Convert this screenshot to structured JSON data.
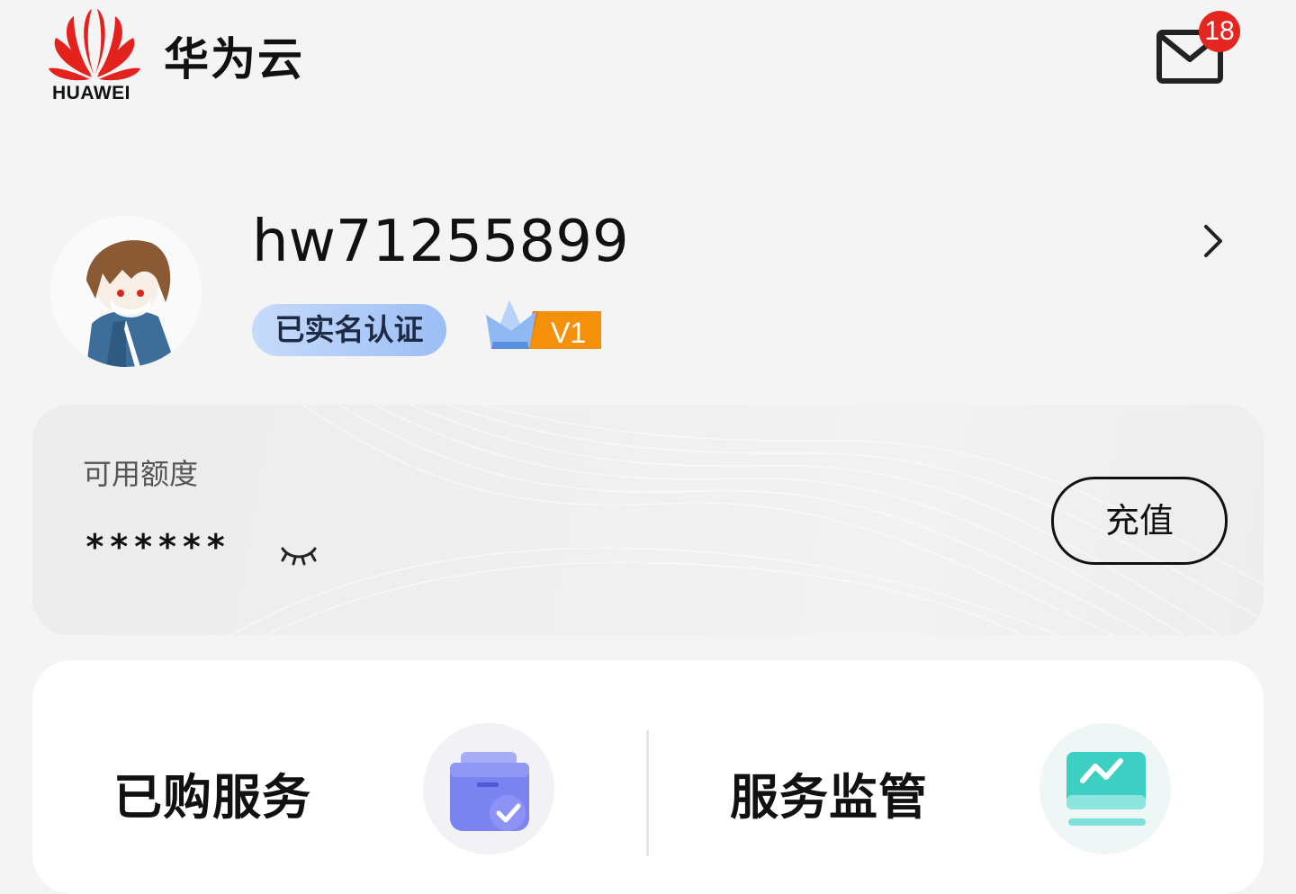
{
  "header": {
    "logo_text": "HUAWEI",
    "brand_name": "华为云",
    "mail_icon": "mail-icon",
    "unread_count": "18"
  },
  "profile": {
    "username": "hw71255899",
    "verified_label": "已实名认证",
    "level_label": "V1",
    "avatar": "avatar-image",
    "chevron_icon": "chevron-right-icon"
  },
  "balance": {
    "label": "可用额度",
    "value": "******",
    "visibility_icon": "eye-closed-icon",
    "recharge_label": "充值"
  },
  "services": [
    {
      "label": "已购服务",
      "icon": "purchased-services-icon"
    },
    {
      "label": "服务监管",
      "icon": "monitoring-icon"
    }
  ],
  "colors": {
    "background": "#f4f4f4",
    "badge_red": "#e5251f",
    "verified_blue": "#9bbef5",
    "level_orange": "#f5900b",
    "purple_icon": "#7b83f0",
    "teal_icon": "#3ecfc4"
  }
}
